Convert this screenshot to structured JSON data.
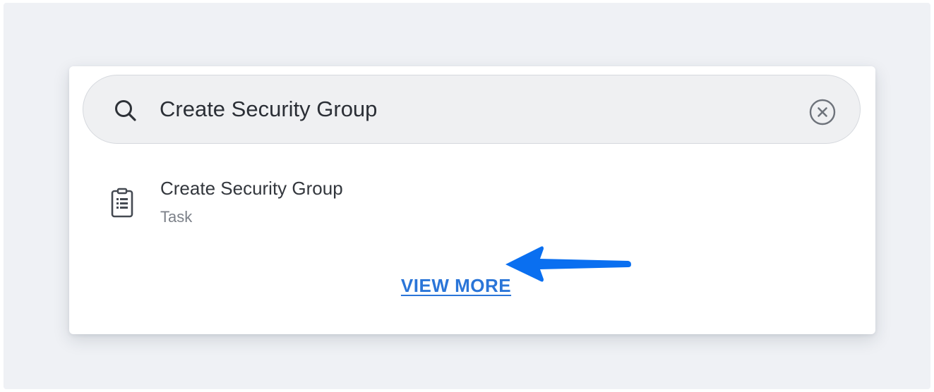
{
  "search": {
    "query": "Create Security Group",
    "search_icon": "search-icon",
    "clear_icon": "clear-circle-icon"
  },
  "results": [
    {
      "title": "Create Security Group",
      "type": "Task",
      "icon": "clipboard-list-icon"
    }
  ],
  "footer": {
    "view_more_label": "VIEW MORE"
  },
  "annotation": {
    "arrow_color": "#0a6ff0",
    "arrow_icon": "arrow-left-icon"
  },
  "colors": {
    "link": "#2a75d8",
    "background": "#eff1f5"
  }
}
